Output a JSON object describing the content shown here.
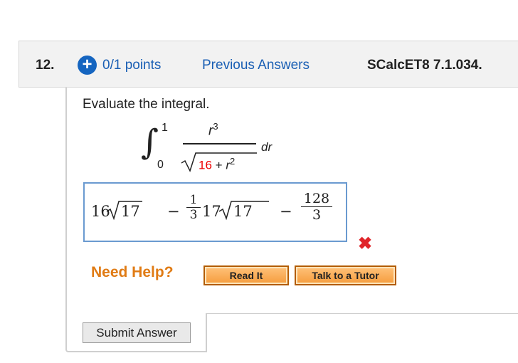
{
  "header": {
    "question_number": "12.",
    "points": "0/1 points",
    "previous_answers": "Previous Answers",
    "source": "SCalcET8 7.1.034."
  },
  "question": {
    "prompt": "Evaluate the integral.",
    "integral": {
      "upper_limit": "1",
      "lower_limit": "0",
      "numerator": "r3",
      "denominator_red": "16",
      "denominator_rest_plus": "+",
      "denominator_var": "r",
      "denominator_exp": "2",
      "differential": "dr"
    }
  },
  "answer": {
    "term1_coef": "16",
    "term1_radicand": "17",
    "minus1": "−",
    "frac1_num": "1",
    "frac1_den": "3",
    "term2_coef": "17",
    "term2_radicand": "17",
    "minus2": "−",
    "frac2_num": "128",
    "frac2_den": "3",
    "status": "incorrect"
  },
  "help": {
    "label": "Need Help?",
    "read_it": "Read It",
    "talk_to_tutor": "Talk to a Tutor"
  },
  "submit": {
    "label": "Submit Answer"
  },
  "colors": {
    "link_blue": "#1a5fb4",
    "help_orange": "#e07b14",
    "error_red": "#e0252a",
    "answer_border": "#6a9ad0"
  }
}
